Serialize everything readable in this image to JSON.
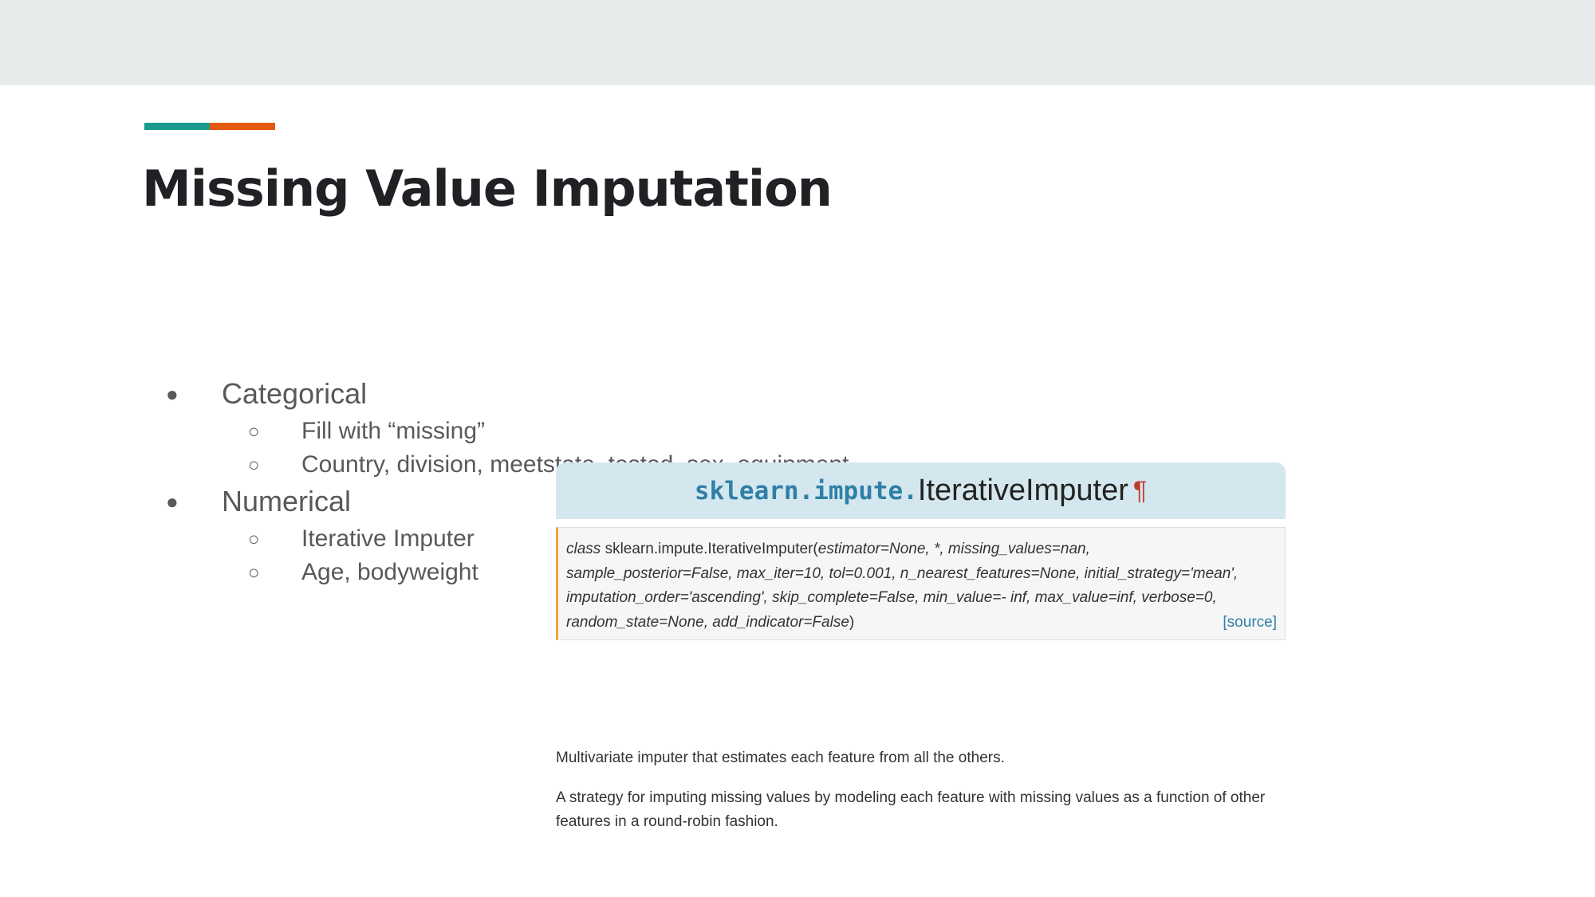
{
  "slide": {
    "title": "Missing Value Imputation",
    "accent_colors": [
      "#1a9b8d",
      "#e4580f"
    ]
  },
  "bullets": [
    {
      "marker": "●",
      "text": "Categorical"
    },
    {
      "marker": "○",
      "text": "Fill with “missing”"
    },
    {
      "marker": "○",
      "text": "Country, division, meetstate, tested, sex, equipment"
    },
    {
      "marker": "●",
      "text": "Numerical"
    },
    {
      "marker": "○",
      "text": "Iterative Imputer"
    },
    {
      "marker": "○",
      "text": "Age, bodyweight"
    }
  ],
  "doc": {
    "header_module": "sklearn.impute.",
    "header_class": "IterativeImputer",
    "header_pilcrow": "¶",
    "sig_keyword": "class",
    "sig_name": "sklearn.impute.IterativeImputer(",
    "sig_line1_params": "estimator=None, *, missing_values=nan,",
    "sig_line2": "sample_posterior=False, max_iter=10, tol=0.001, n_nearest_features=None, initial_strategy='mean',",
    "sig_line3": "imputation_order='ascending', skip_complete=False, min_value=- inf, max_value=inf, verbose=0,",
    "sig_line4": "random_state=None, add_indicator=False",
    "sig_close": ")",
    "source_link": "[source]",
    "desc1": "Multivariate imputer that estimates each feature from all the others.",
    "desc2": "A strategy for imputing missing values by modeling each feature with missing values as a function of other features in a round-robin fashion."
  }
}
